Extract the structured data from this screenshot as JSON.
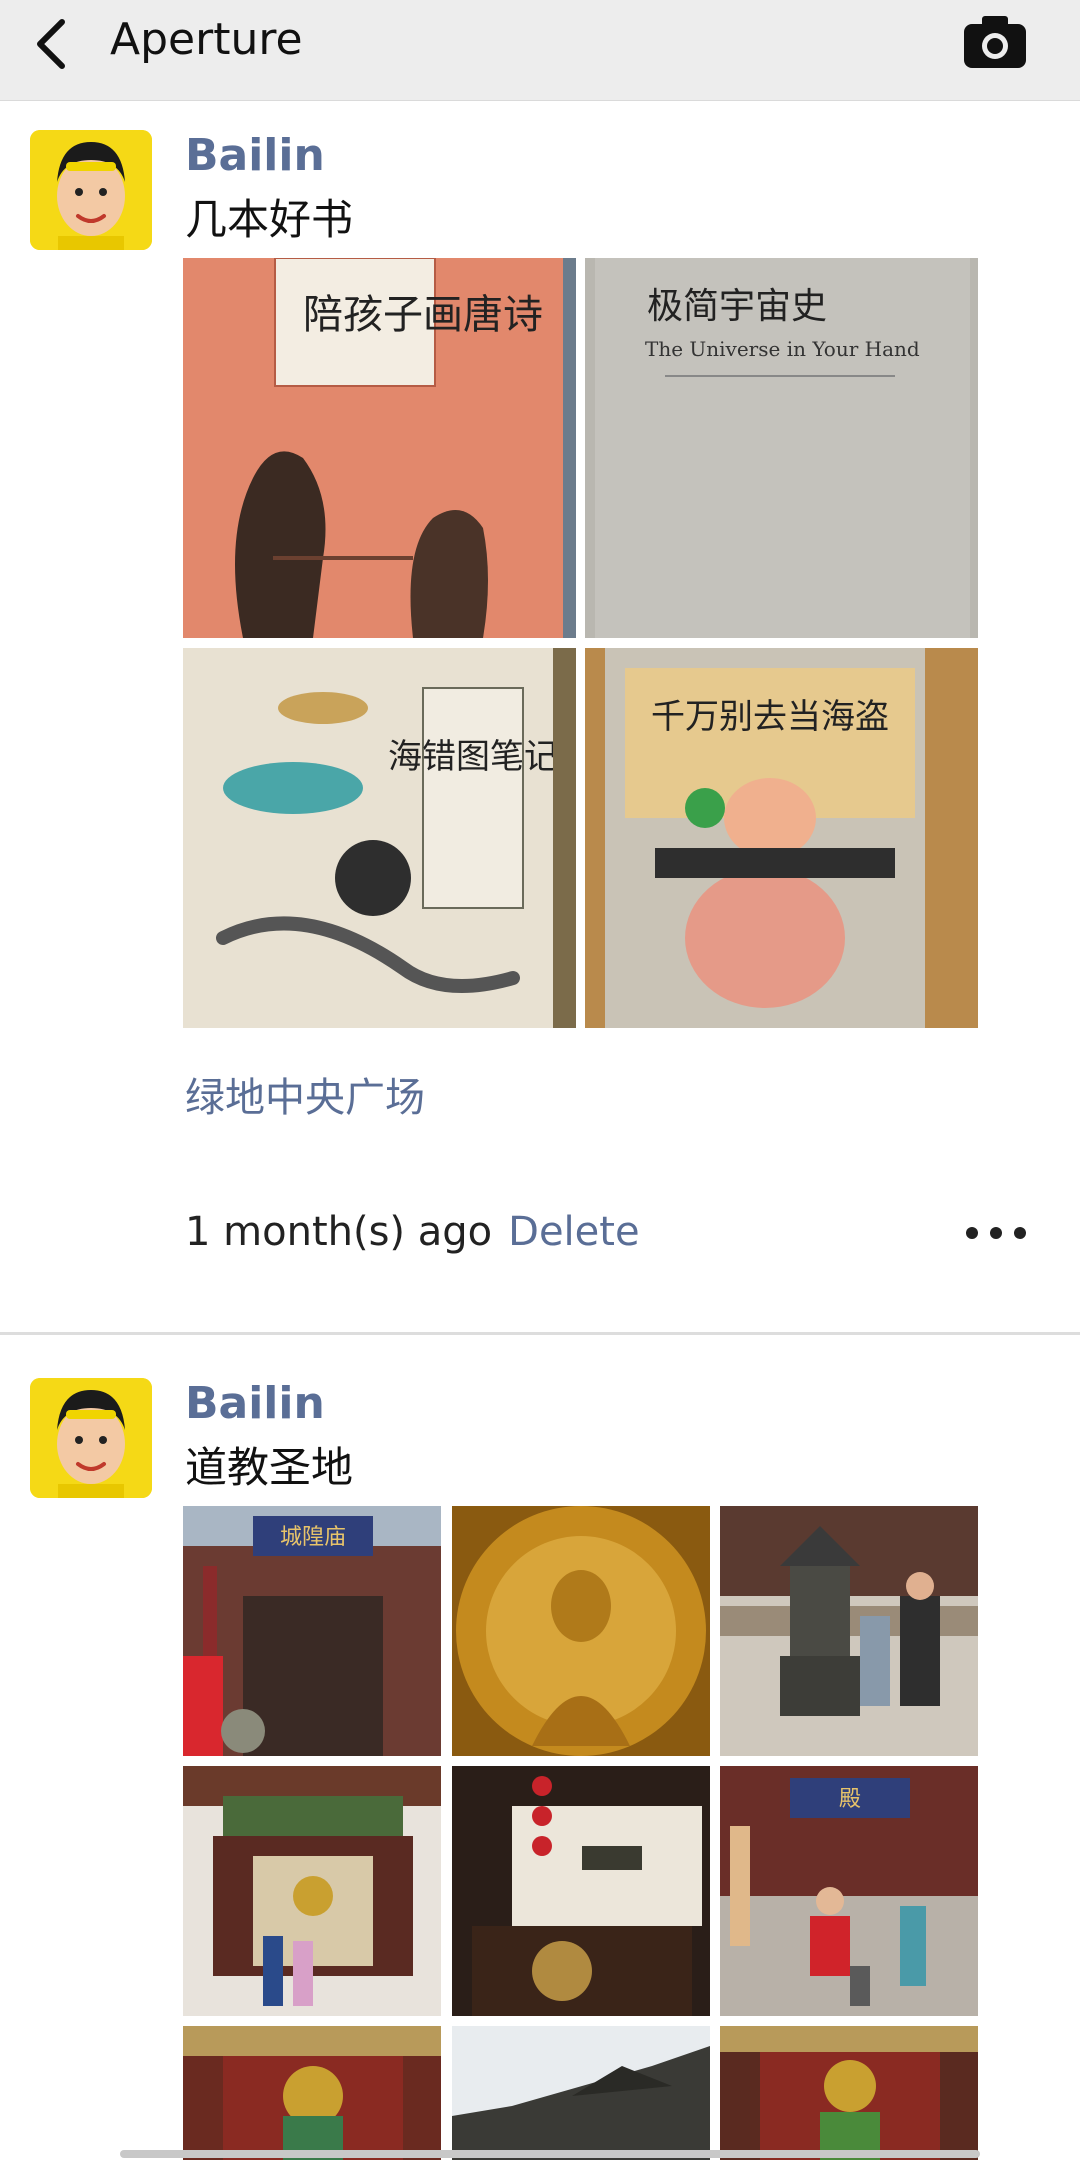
{
  "header": {
    "title": "Aperture",
    "back_icon": "chevron-left-icon",
    "camera_icon": "camera-icon"
  },
  "posts": [
    {
      "username": "Bailin",
      "text": "几本好书",
      "location": "绿地中央广场",
      "time": "1 month(s) ago",
      "delete_label": "Delete",
      "more_icon": "more-icon",
      "photos": [
        {
          "caption": "陪孩子画唐诗"
        },
        {
          "caption": "极简宇宙史",
          "subtitle": "The Universe in Your Hand"
        },
        {
          "caption": "海错图笔记"
        },
        {
          "caption": "千万别去当海盗"
        }
      ]
    },
    {
      "username": "Bailin",
      "text": "道教圣地",
      "photos": [
        {
          "caption": "城隍庙"
        },
        {
          "caption": ""
        },
        {
          "caption": ""
        },
        {
          "caption": ""
        },
        {
          "caption": ""
        },
        {
          "caption": "殿"
        },
        {
          "caption": ""
        },
        {
          "caption": ""
        },
        {
          "caption": ""
        }
      ]
    }
  ],
  "colors": {
    "name_link": "#5a6e96",
    "header_bg": "#ededed",
    "divider": "#dddddd"
  }
}
